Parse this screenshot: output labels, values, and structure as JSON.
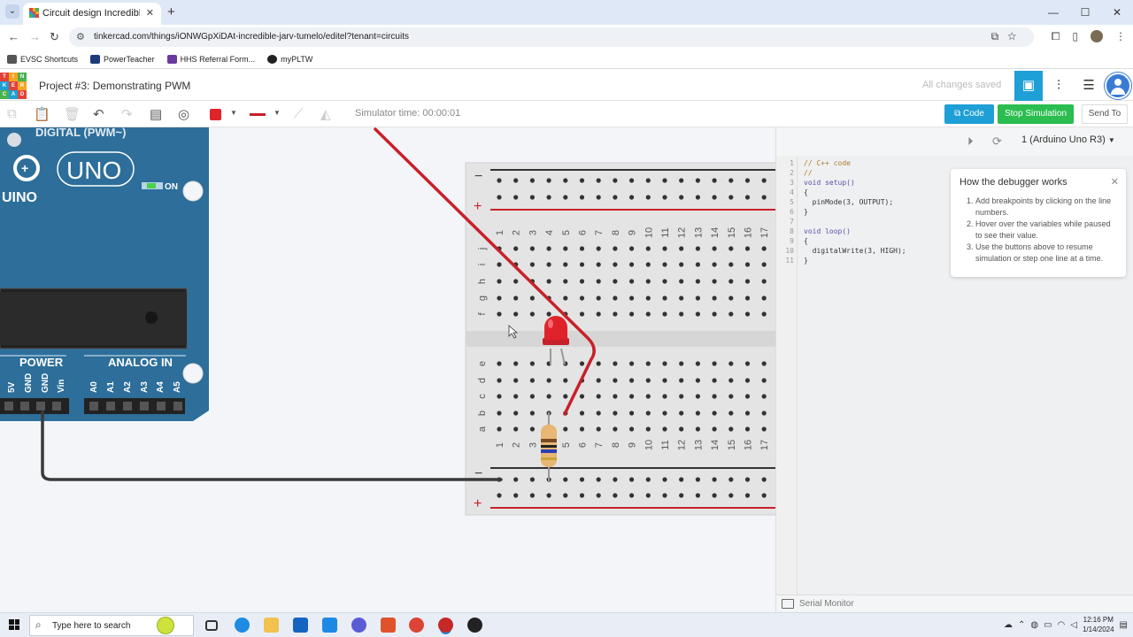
{
  "browser": {
    "tab_title": "Circuit design Incredible Jarv-Tu",
    "tab_close": "✕",
    "new_tab": "+",
    "url": "tinkercad.com/things/iONWGpXiDAt-incredible-jarv-tumelo/editel?tenant=circuits",
    "window_controls": [
      "—",
      "☐",
      "✕"
    ],
    "bookmarks": [
      {
        "label": "EVSC Shortcuts",
        "icon_color": "#555555"
      },
      {
        "label": "PowerTeacher",
        "icon_color": "#1e3a7a"
      },
      {
        "label": "HHS Referral Form...",
        "icon_color": "#6a3aa0"
      },
      {
        "label": "myPLTW",
        "icon_color": "#222222"
      }
    ]
  },
  "tinkercad": {
    "logo_letters": [
      "TIN",
      "KER",
      "CAD"
    ],
    "logo_colors": [
      "#e2423a",
      "#f5a623",
      "#4ab24f",
      "#1e9fd6",
      "#e2423a",
      "#f5a623",
      "#4ab24f",
      "#1e9fd6",
      "#e2423a"
    ],
    "project_title": "Project #3: Demonstrating PWM",
    "saved_status": "All changes saved",
    "simulator_time": "Simulator time: 00:00:01",
    "code_button": "Code",
    "stop_button": "Stop Simulation",
    "send_button": "Send To",
    "wire_color": "#e0232b"
  },
  "circuit": {
    "board_name": "UNO",
    "board_brand": "UINO",
    "header_label": "DIGITAL (PWM~)",
    "on_label": "ON",
    "power_label": "POWER",
    "analog_label": "ANALOG IN",
    "power_pins": [
      "5V",
      "GND",
      "GND",
      "Vin"
    ],
    "analog_pins": [
      "A0",
      "A1",
      "A2",
      "A3",
      "A4",
      "A5"
    ],
    "rail_minus": "−",
    "rail_plus": "+",
    "row_letters_top": [
      "j",
      "i",
      "h",
      "g",
      "f"
    ],
    "row_letters_bottom": [
      "e",
      "d",
      "c",
      "b",
      "a"
    ],
    "columns": [
      "1",
      "2",
      "3",
      "4",
      "5",
      "6",
      "7",
      "8",
      "9",
      "10",
      "11",
      "12",
      "13",
      "14",
      "15",
      "16",
      "17"
    ]
  },
  "code_panel": {
    "device": "1 (Arduino Uno R3)",
    "line_numbers": [
      "1",
      "2",
      "3",
      "4",
      "5",
      "6",
      "7",
      "8",
      "9",
      "10",
      "11"
    ],
    "lines": [
      "// C++ code",
      "//",
      "void setup()",
      "{",
      "  pinMode(3, OUTPUT);",
      "}",
      "",
      "void loop()",
      "{",
      "  digitalWrite(3, HIGH);",
      "}"
    ],
    "debugger_title": "How the debugger works",
    "debugger_close": "✕",
    "debugger_steps": [
      "Add breakpoints by clicking on the line numbers.",
      "Hover over the variables while paused to see their value.",
      "Use the buttons above to resume simulation or step one line at a time."
    ],
    "serial_monitor": "Serial Monitor"
  },
  "taskbar": {
    "search_placeholder": "Type here to search",
    "time": "12:16 PM",
    "date": "1/14/2024",
    "apps": [
      {
        "name": "task-view",
        "color": "#333333"
      },
      {
        "name": "edge",
        "color": "#1f8be0"
      },
      {
        "name": "file-explorer",
        "color": "#f2c14e"
      },
      {
        "name": "store",
        "color": "#1565c0"
      },
      {
        "name": "mail",
        "color": "#1e88e5"
      },
      {
        "name": "app-purple",
        "color": "#5b5bd6"
      },
      {
        "name": "app-orange",
        "color": "#e0522a"
      },
      {
        "name": "chrome",
        "color": "#db4437"
      },
      {
        "name": "chrome-profile",
        "color": "#c62828"
      },
      {
        "name": "app-dark",
        "color": "#222222"
      }
    ]
  }
}
